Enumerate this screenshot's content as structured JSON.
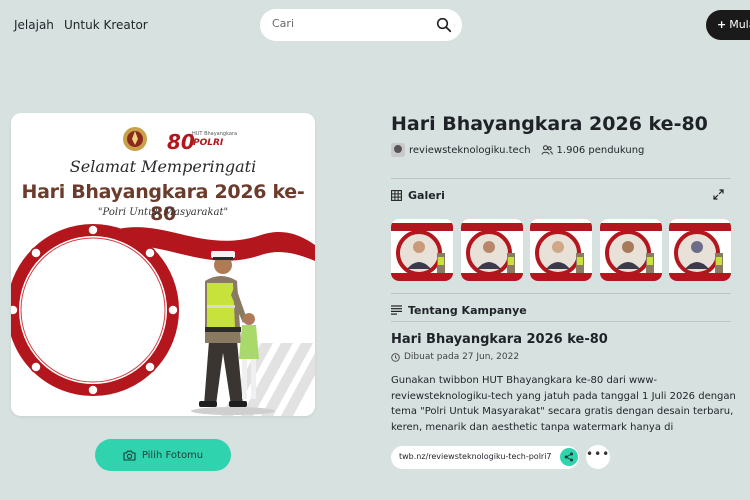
{
  "nav": {
    "explore": "Jelajah",
    "for_creators": "Untuk Kreator",
    "search_placeholder": "Cari",
    "create_label": "Mulai"
  },
  "twibbon": {
    "greeting": "Selamat Memperingati",
    "title": "Hari Bhayangkara 2026 ke-80",
    "slogan": "\"Polri Untuk Masyarakat\"",
    "choose_photo_label": "Pilih Fotomu"
  },
  "campaign": {
    "title": "Hari Bhayangkara 2026 ke-80",
    "creator": "reviewsteknologiku.tech",
    "supporters": "1.906 pendukung"
  },
  "gallery": {
    "heading": "Galeri",
    "thumb_count": 5
  },
  "about": {
    "heading": "Tentang Kampanye",
    "title": "Hari Bhayangkara 2026 ke-80",
    "created": "Dibuat pada 27 Jun, 2022",
    "description": "Gunakan twibbon HUT Bhayangkara ke-80 dari www-reviewsteknologiku-tech yang jatuh pada tanggal 1 Juli 2026 dengan tema \"Polri Untuk Masyarakat\" secara gratis dengan desain terbaru, keren, menarik dan aesthetic tanpa watermark hanya di",
    "link": "twb.nz/reviewsteknologiku-tech-polri7"
  },
  "colors": {
    "background": "#d7e1df",
    "accent": "#2fd4ae",
    "frame_red": "#b3161d",
    "title_brown": "#6b3b2c"
  },
  "icons": [
    "search-icon",
    "plus-icon",
    "camera-icon",
    "people-icon",
    "grid-icon",
    "expand-icon",
    "text-lines-icon",
    "clock-icon",
    "share-icon",
    "more-icon"
  ]
}
